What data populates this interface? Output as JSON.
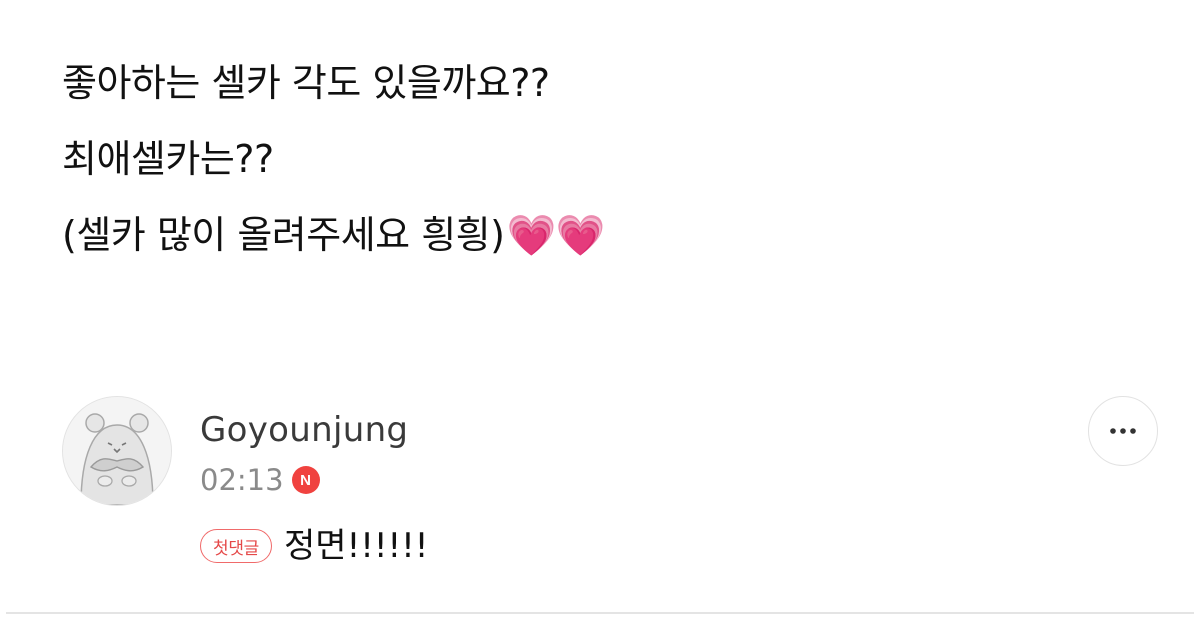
{
  "post": {
    "lines": [
      "좋아하는 셀카 각도 있을까요??",
      "최애셀카는??",
      "(셀카 많이 올려주세요 힁힁)"
    ],
    "hearts": "💗💗"
  },
  "comment": {
    "author": "Goyounjung",
    "time": "02:13",
    "new_badge": "N",
    "first_comment_badge": "첫댓글",
    "text": "정면!!!!!!",
    "avatar_icon": "hamster-avatar-icon",
    "more_icon": "more-dots-icon"
  },
  "colors": {
    "heart": "#f0238f",
    "new_badge": "#f0423f",
    "first_badge_border": "#f06a6a"
  }
}
